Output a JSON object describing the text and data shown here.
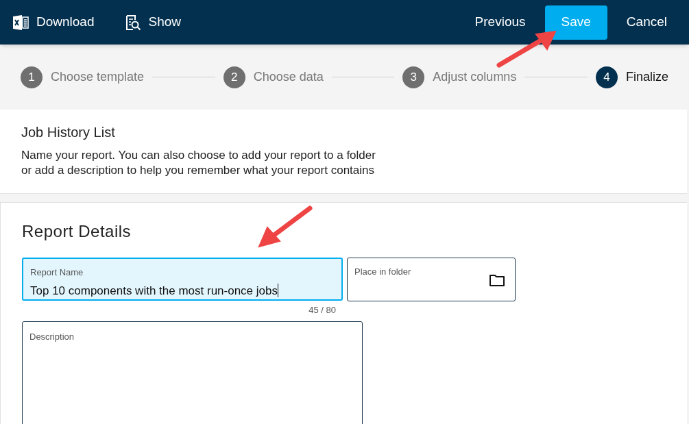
{
  "toolbar": {
    "left_buttons": [
      {
        "kind": "excel",
        "label": "Download"
      },
      {
        "kind": "preview",
        "label": "Show"
      }
    ],
    "right_buttons": [
      {
        "label": "Previous",
        "primary": false
      },
      {
        "label": "Save",
        "primary": true
      },
      {
        "label": "Cancel",
        "primary": false
      }
    ]
  },
  "steps": [
    {
      "number": "1",
      "label": "Choose template",
      "selected": false
    },
    {
      "number": "2",
      "label": "Choose data",
      "selected": false
    },
    {
      "number": "3",
      "label": "Adjust columns",
      "selected": false
    },
    {
      "number": "4",
      "label": "Finalize",
      "selected": true
    }
  ],
  "intro": {
    "title": "Job History List",
    "text": "Name your report. You can also choose to add your report to a folder\nor add a description to help you remember what your report contains"
  },
  "details": {
    "title": "Report Details",
    "report_name": {
      "label": "Report Name",
      "value": "Top 10 components with the most run-once jobs",
      "focused": true,
      "counter": "45 / 80"
    },
    "folder": {
      "label": "Place in folder"
    },
    "description": {
      "label": "Description"
    }
  }
}
